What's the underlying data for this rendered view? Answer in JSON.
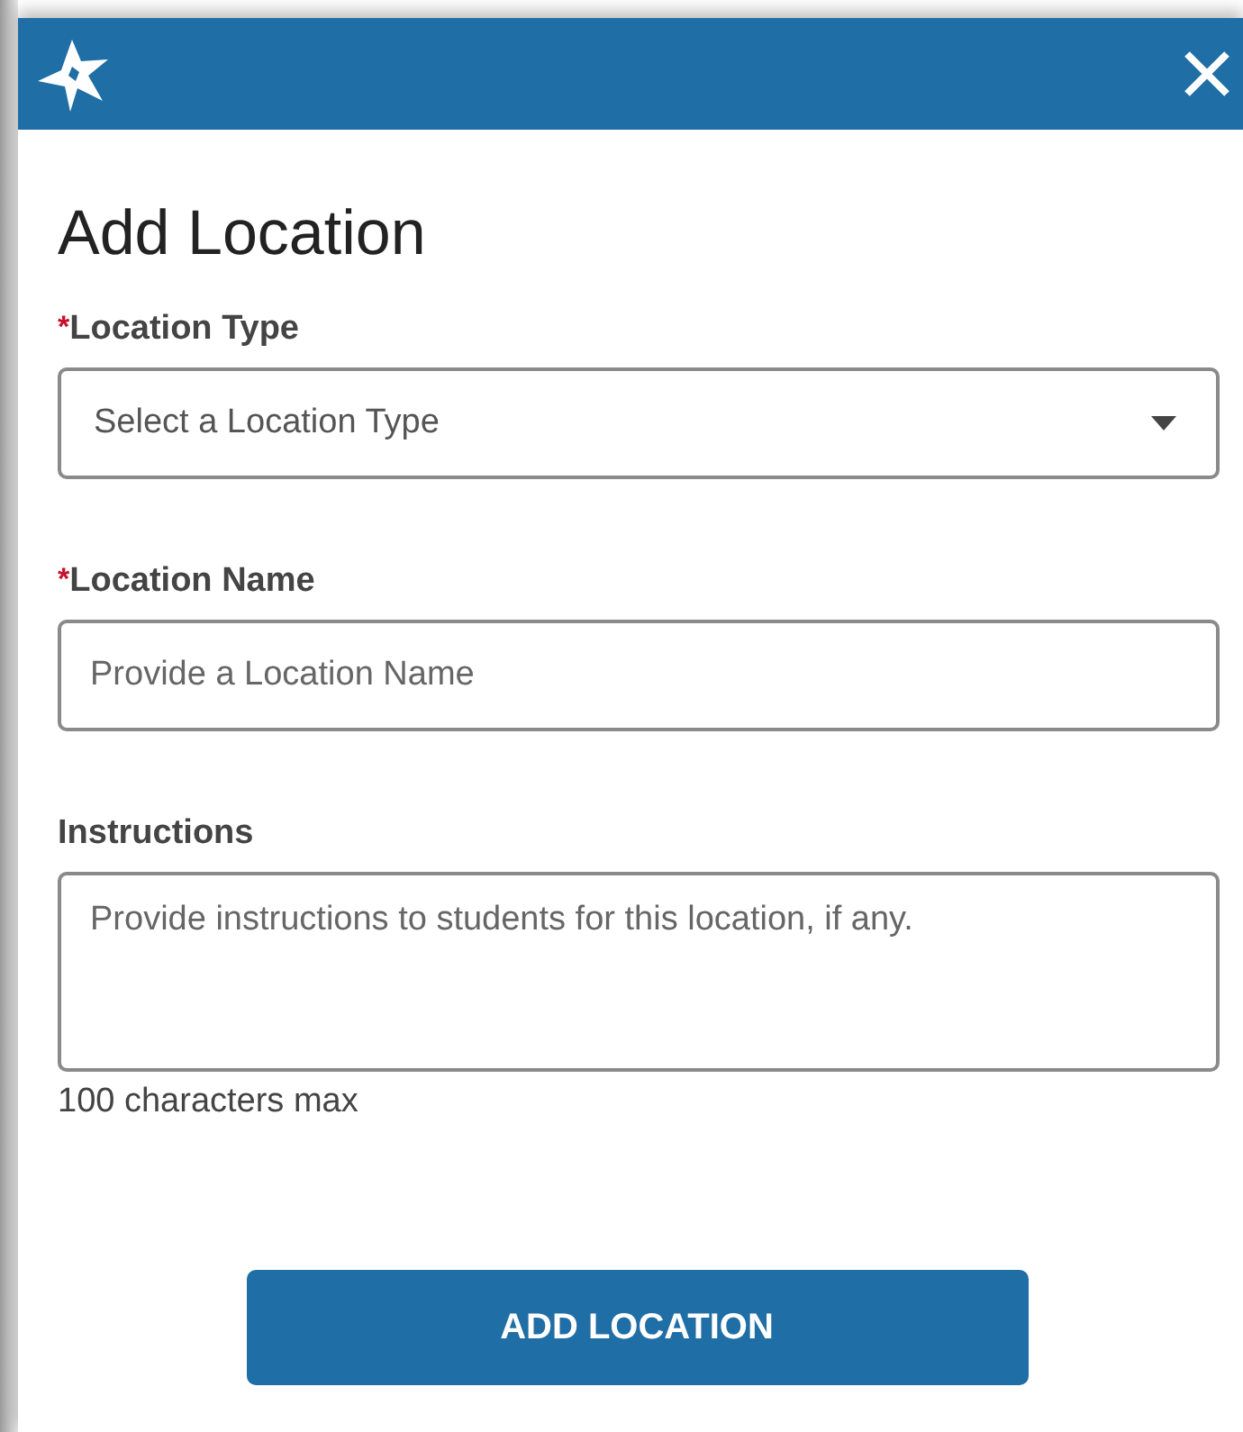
{
  "dialog": {
    "title": "Add Location"
  },
  "fields": [
    {
      "kind": "select",
      "label": "Location Type",
      "required_mark": "*",
      "placeholder": "Select a Location Type"
    },
    {
      "kind": "text",
      "label": "Location Name",
      "required_mark": "*",
      "placeholder": "Provide a Location Name"
    },
    {
      "kind": "textarea",
      "label": "Instructions",
      "placeholder": "Provide instructions to students for this location, if any.",
      "hint": "100 characters max"
    }
  ],
  "submit_button": "ADD LOCATION"
}
